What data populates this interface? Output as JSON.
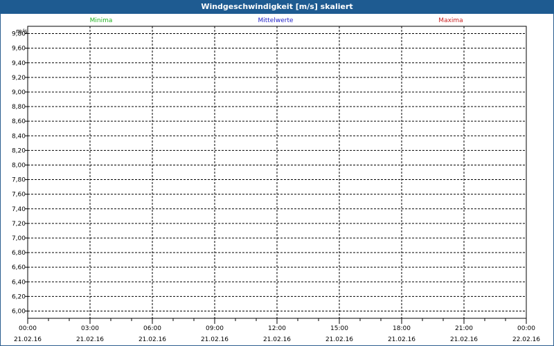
{
  "window": {
    "title": "Windgeschwindigkeit [m/s] skaliert"
  },
  "colors": {
    "title_bg": "#1e5b91",
    "minima": "#22b422",
    "mittelwerte": "#2020c8",
    "maxima": "#c81e1e"
  },
  "chart_data": {
    "type": "line",
    "title": "Windgeschwindigkeit [m/s] skaliert",
    "ylabel": "m/s",
    "xlabel": "",
    "ylim": [
      5.9,
      9.9
    ],
    "y_ticks": [
      "9,80",
      "9,60",
      "9,40",
      "9,20",
      "9,00",
      "8,80",
      "8,60",
      "8,40",
      "8,20",
      "8,00",
      "7,80",
      "7,60",
      "7,40",
      "7,20",
      "7,00",
      "6,80",
      "6,60",
      "6,40",
      "6,20",
      "6,00"
    ],
    "x_ticks": [
      {
        "time": "00:00",
        "date": "21.02.16"
      },
      {
        "time": "03:00",
        "date": "21.02.16"
      },
      {
        "time": "06:00",
        "date": "21.02.16"
      },
      {
        "time": "09:00",
        "date": "21.02.16"
      },
      {
        "time": "12:00",
        "date": "21.02.16"
      },
      {
        "time": "15:00",
        "date": "21.02.16"
      },
      {
        "time": "18:00",
        "date": "21.02.16"
      },
      {
        "time": "21:00",
        "date": "21.02.16"
      },
      {
        "time": "00:00",
        "date": "22.02.16"
      }
    ],
    "series": [
      {
        "name": "Minima",
        "values": []
      },
      {
        "name": "Mittelwerte",
        "values": []
      },
      {
        "name": "Maxima",
        "values": []
      }
    ],
    "grid": true,
    "legend_position": "top"
  }
}
